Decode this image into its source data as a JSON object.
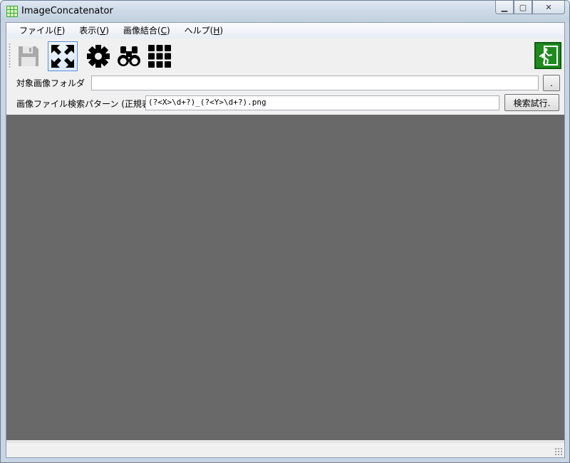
{
  "window": {
    "title": "ImageConcatenator",
    "minimize_glyph": "▁",
    "maximize_glyph": "▢",
    "close_glyph": "✕"
  },
  "menu": [
    {
      "label": "ファイル(",
      "mnemonic": "F",
      "suffix": ")"
    },
    {
      "label": "表示(",
      "mnemonic": "V",
      "suffix": ")"
    },
    {
      "label": "画像結合(",
      "mnemonic": "C",
      "suffix": ")"
    },
    {
      "label": "ヘルプ(",
      "mnemonic": "H",
      "suffix": ")"
    }
  ],
  "toolbar": {
    "icons": [
      "save-icon",
      "fit-screen-icon",
      "settings-gear-icon",
      "binoculars-search-icon",
      "grid-icon",
      "exit-icon"
    ],
    "accent_exit": "#1f8a1f"
  },
  "folder": {
    "label": "対象画像フォルダ",
    "value": "",
    "browse_label": "."
  },
  "pattern": {
    "label": "画像ファイル検索パターン (正規表",
    "value": "(?<X>\\d+?)_(?<Y>\\d+?).png",
    "test_label": "検索試行."
  },
  "colors": {
    "canvas": "#696969"
  }
}
